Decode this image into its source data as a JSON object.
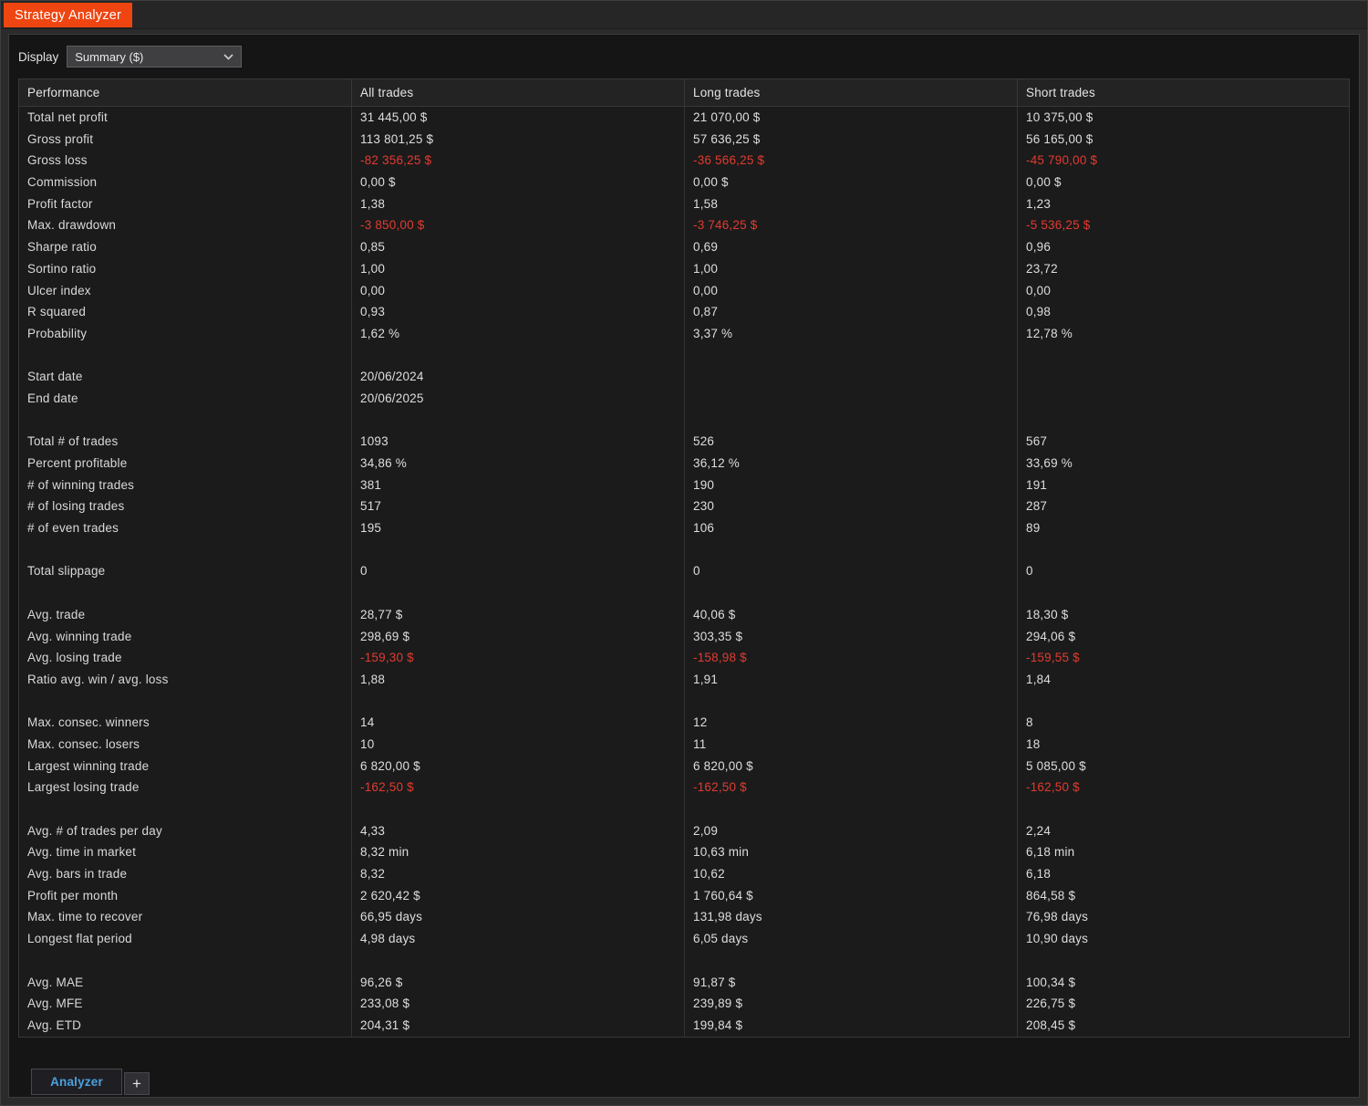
{
  "window": {
    "title": "Strategy Analyzer"
  },
  "toolbar": {
    "display_label": "Display",
    "display_value": "Summary ($)"
  },
  "table": {
    "columns": [
      "Performance",
      "All trades",
      "Long trades",
      "Short trades"
    ],
    "rows": [
      {
        "label": "Total net profit",
        "values": [
          "31 445,00 $",
          "21 070,00 $",
          "10 375,00 $"
        ]
      },
      {
        "label": "Gross profit",
        "values": [
          "113 801,25 $",
          "57 636,25 $",
          "56 165,00 $"
        ]
      },
      {
        "label": "Gross loss",
        "values": [
          "-82 356,25 $",
          "-36 566,25 $",
          "-45 790,00 $"
        ]
      },
      {
        "label": "Commission",
        "values": [
          "0,00 $",
          "0,00 $",
          "0,00 $"
        ]
      },
      {
        "label": "Profit factor",
        "values": [
          "1,38",
          "1,58",
          "1,23"
        ]
      },
      {
        "label": "Max. drawdown",
        "values": [
          "-3 850,00 $",
          "-3 746,25 $",
          "-5 536,25 $"
        ]
      },
      {
        "label": "Sharpe ratio",
        "values": [
          "0,85",
          "0,69",
          "0,96"
        ]
      },
      {
        "label": "Sortino ratio",
        "values": [
          "1,00",
          "1,00",
          "23,72"
        ]
      },
      {
        "label": "Ulcer index",
        "values": [
          "0,00",
          "0,00",
          "0,00"
        ]
      },
      {
        "label": "R squared",
        "values": [
          "0,93",
          "0,87",
          "0,98"
        ]
      },
      {
        "label": "Probability",
        "values": [
          "1,62 %",
          "3,37 %",
          "12,78 %"
        ]
      },
      {
        "label": "",
        "values": [
          "",
          "",
          ""
        ]
      },
      {
        "label": "Start date",
        "values": [
          "20/06/2024",
          "",
          ""
        ]
      },
      {
        "label": "End date",
        "values": [
          "20/06/2025",
          "",
          ""
        ]
      },
      {
        "label": "",
        "values": [
          "",
          "",
          ""
        ]
      },
      {
        "label": "Total # of trades",
        "values": [
          "1093",
          "526",
          "567"
        ]
      },
      {
        "label": "Percent profitable",
        "values": [
          "34,86 %",
          "36,12 %",
          "33,69 %"
        ]
      },
      {
        "label": "# of winning trades",
        "values": [
          "381",
          "190",
          "191"
        ]
      },
      {
        "label": "# of losing trades",
        "values": [
          "517",
          "230",
          "287"
        ]
      },
      {
        "label": "# of even trades",
        "values": [
          "195",
          "106",
          "89"
        ]
      },
      {
        "label": "",
        "values": [
          "",
          "",
          ""
        ]
      },
      {
        "label": "Total slippage",
        "values": [
          "0",
          "0",
          "0"
        ]
      },
      {
        "label": "",
        "values": [
          "",
          "",
          ""
        ]
      },
      {
        "label": "Avg. trade",
        "values": [
          "28,77 $",
          "40,06 $",
          "18,30 $"
        ]
      },
      {
        "label": "Avg. winning trade",
        "values": [
          "298,69 $",
          "303,35 $",
          "294,06 $"
        ]
      },
      {
        "label": "Avg. losing trade",
        "values": [
          "-159,30 $",
          "-158,98 $",
          "-159,55 $"
        ]
      },
      {
        "label": "Ratio avg. win / avg. loss",
        "values": [
          "1,88",
          "1,91",
          "1,84"
        ]
      },
      {
        "label": "",
        "values": [
          "",
          "",
          ""
        ]
      },
      {
        "label": "Max. consec. winners",
        "values": [
          "14",
          "12",
          "8"
        ]
      },
      {
        "label": "Max. consec. losers",
        "values": [
          "10",
          "11",
          "18"
        ]
      },
      {
        "label": "Largest winning trade",
        "values": [
          "6 820,00 $",
          "6 820,00 $",
          "5 085,00 $"
        ]
      },
      {
        "label": "Largest losing trade",
        "values": [
          "-162,50 $",
          "-162,50 $",
          "-162,50 $"
        ]
      },
      {
        "label": "",
        "values": [
          "",
          "",
          ""
        ]
      },
      {
        "label": "Avg. # of trades per day",
        "values": [
          "4,33",
          "2,09",
          "2,24"
        ]
      },
      {
        "label": "Avg. time in market",
        "values": [
          "8,32 min",
          "10,63 min",
          "6,18 min"
        ]
      },
      {
        "label": "Avg. bars in trade",
        "values": [
          "8,32",
          "10,62",
          "6,18"
        ]
      },
      {
        "label": "Profit per month",
        "values": [
          "2 620,42 $",
          "1 760,64 $",
          "864,58 $"
        ]
      },
      {
        "label": "Max. time to recover",
        "values": [
          "66,95 days",
          "131,98 days",
          "76,98 days"
        ]
      },
      {
        "label": "Longest flat period",
        "values": [
          "4,98 days",
          "6,05 days",
          "10,90 days"
        ]
      },
      {
        "label": "",
        "values": [
          "",
          "",
          ""
        ]
      },
      {
        "label": "Avg. MAE",
        "values": [
          "96,26 $",
          "91,87 $",
          "100,34 $"
        ]
      },
      {
        "label": "Avg. MFE",
        "values": [
          "233,08 $",
          "239,89 $",
          "226,75 $"
        ]
      },
      {
        "label": "Avg. ETD",
        "values": [
          "204,31 $",
          "199,84 $",
          "208,45 $"
        ]
      }
    ]
  },
  "bottom_tabs": {
    "analyzer_label": "Analyzer",
    "add_label": "+"
  },
  "colors": {
    "accent_orange": "#ee4511",
    "negative_red": "#e23b30",
    "tab_blue": "#4aa0e0"
  }
}
